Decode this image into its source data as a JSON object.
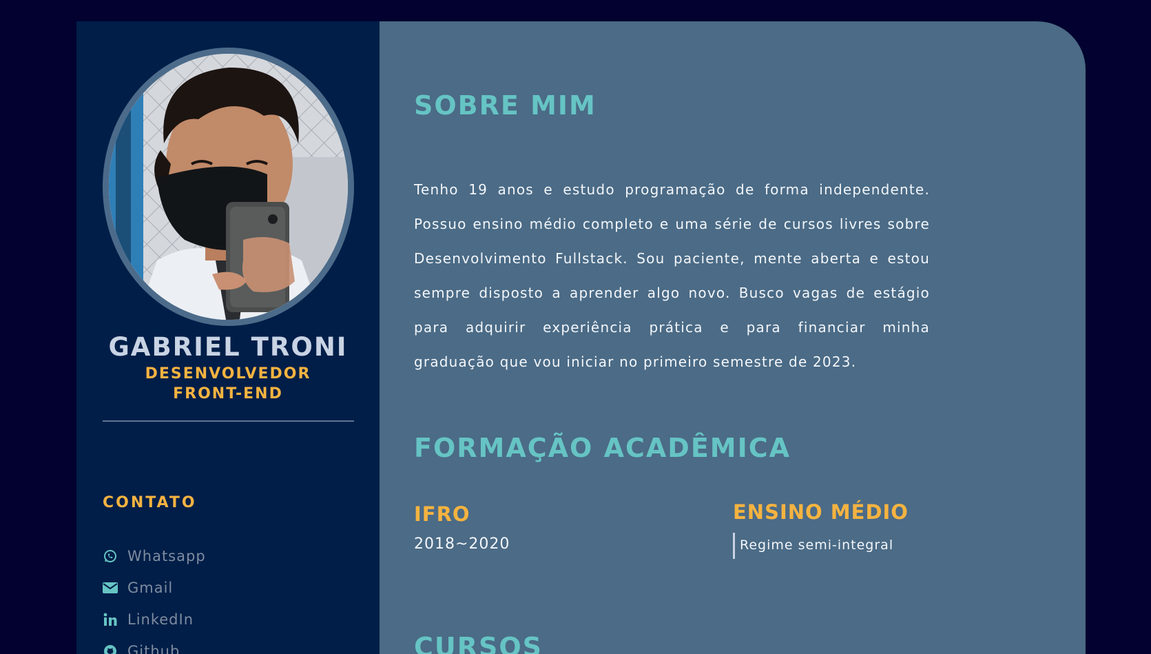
{
  "profile": {
    "name": "GABRIEL TRONI",
    "role_line1": "DESENVOLVEDOR",
    "role_line2": "FRONT-END"
  },
  "contact": {
    "title": "CONTATO",
    "items": [
      {
        "label": "Whatsapp",
        "icon": "whatsapp-icon"
      },
      {
        "label": "Gmail",
        "icon": "envelope-icon"
      },
      {
        "label": "LinkedIn",
        "icon": "linkedin-icon"
      },
      {
        "label": "Github",
        "icon": "github-icon"
      }
    ]
  },
  "about": {
    "title": "SOBRE MIM",
    "text": "Tenho 19 anos e estudo programação de forma independente. Possuo ensino médio completo e uma série de cursos livres sobre Desenvolvimento Fullstack. Sou paciente, mente aberta e estou sempre disposto a aprender algo novo. Busco vagas de estágio para adquirir experiência prática e para financiar minha graduação que vou iniciar no primeiro semestre de 2023."
  },
  "education": {
    "title": "FORMAÇÃO ACADÊMICA",
    "institution": "IFRO",
    "period": "2018~2020",
    "level": "ENSINO MÉDIO",
    "regime": "Regime semi-integral"
  },
  "courses": {
    "title": "CURSOS"
  },
  "colors": {
    "background": "#02012f",
    "sidebar": "#001e48",
    "main": "#4b6b86",
    "accent_teal": "#66c4c4",
    "accent_orange": "#f5b340"
  }
}
